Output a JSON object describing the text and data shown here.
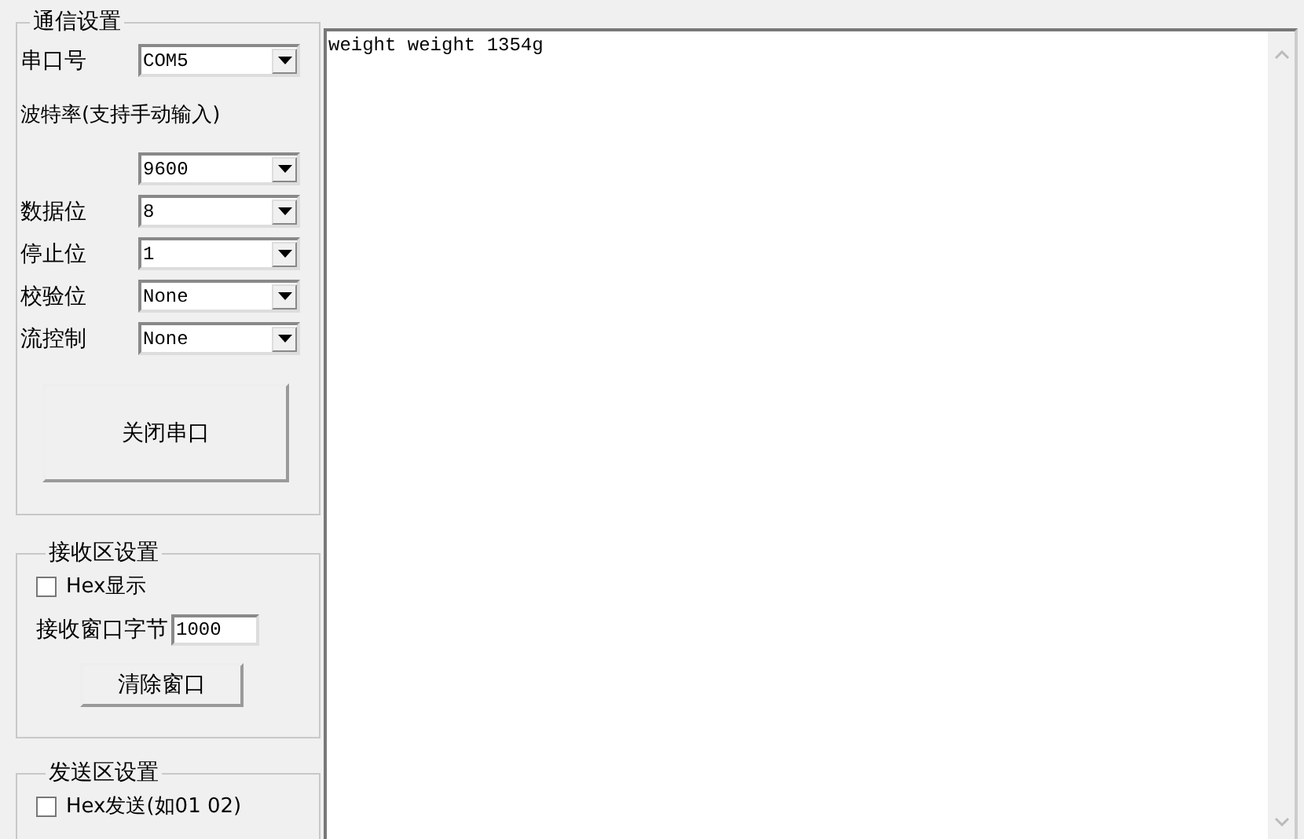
{
  "serial_settings": {
    "title": "通信设置",
    "fields": [
      {
        "kind": "inline",
        "label": "串口号",
        "value": "COM5"
      },
      {
        "kind": "stacked",
        "label": "波特率(支持手动输入)",
        "value": "9600"
      },
      {
        "kind": "inline",
        "label": "数据位",
        "value": "8"
      },
      {
        "kind": "inline",
        "label": "停止位",
        "value": "1"
      },
      {
        "kind": "inline",
        "label": "校验位",
        "value": "None"
      },
      {
        "kind": "inline",
        "label": "流控制",
        "value": "None"
      }
    ],
    "button": "关闭串口"
  },
  "receive_settings": {
    "title": "接收区设置",
    "hex_display": {
      "label": "Hex显示",
      "checked": false
    },
    "window_bytes": {
      "label": "接收窗口字节",
      "value": "1000"
    },
    "button": "清除窗口"
  },
  "send_settings": {
    "title": "发送区设置",
    "hex_send": {
      "label": "Hex发送(如01 02)",
      "checked": false
    }
  },
  "receive_area": {
    "text": "weight weight 1354g"
  }
}
